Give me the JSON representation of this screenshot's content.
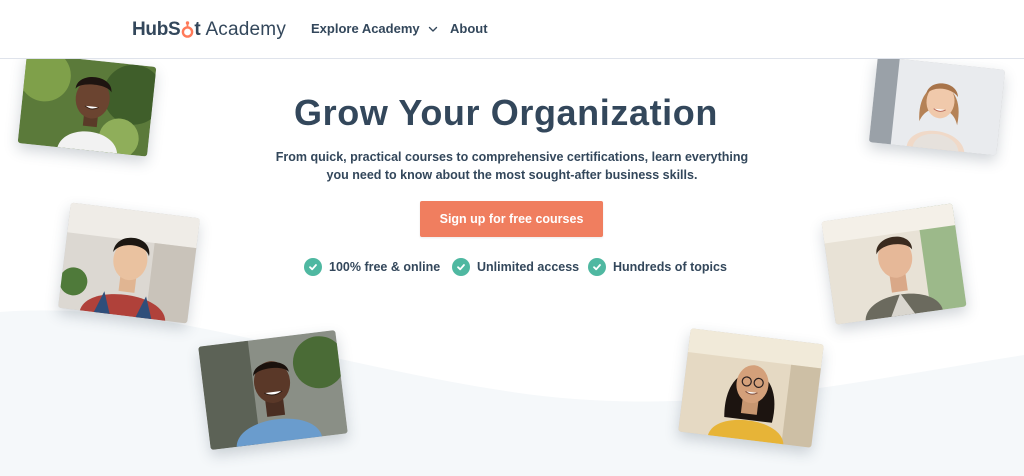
{
  "navbar": {
    "logo_brand_part1": "HubS",
    "logo_brand_part2": "t",
    "logo_sub": "Academy",
    "links": [
      {
        "label": "Explore Academy",
        "has_dropdown": true
      },
      {
        "label": "About",
        "has_dropdown": false
      }
    ]
  },
  "hero": {
    "title": "Grow Your Organization",
    "subtitle_line1": "From quick, practical courses to comprehensive certifications, learn everything",
    "subtitle_line2": "you need to know about the most sought-after business skills.",
    "cta_label": "Sign up for free courses",
    "features": [
      {
        "label": "100% free & online",
        "icon": "check-circle-icon"
      },
      {
        "label": "Unlimited access",
        "icon": "check-circle-icon"
      },
      {
        "label": "Hundreds of topics",
        "icon": "check-circle-icon"
      }
    ]
  },
  "colors": {
    "text": "#33475b",
    "accent": "#f07e5f",
    "check": "#4fb8a1",
    "logo_sprocket": "#ff7a59",
    "wave": "#f5f8fa"
  }
}
